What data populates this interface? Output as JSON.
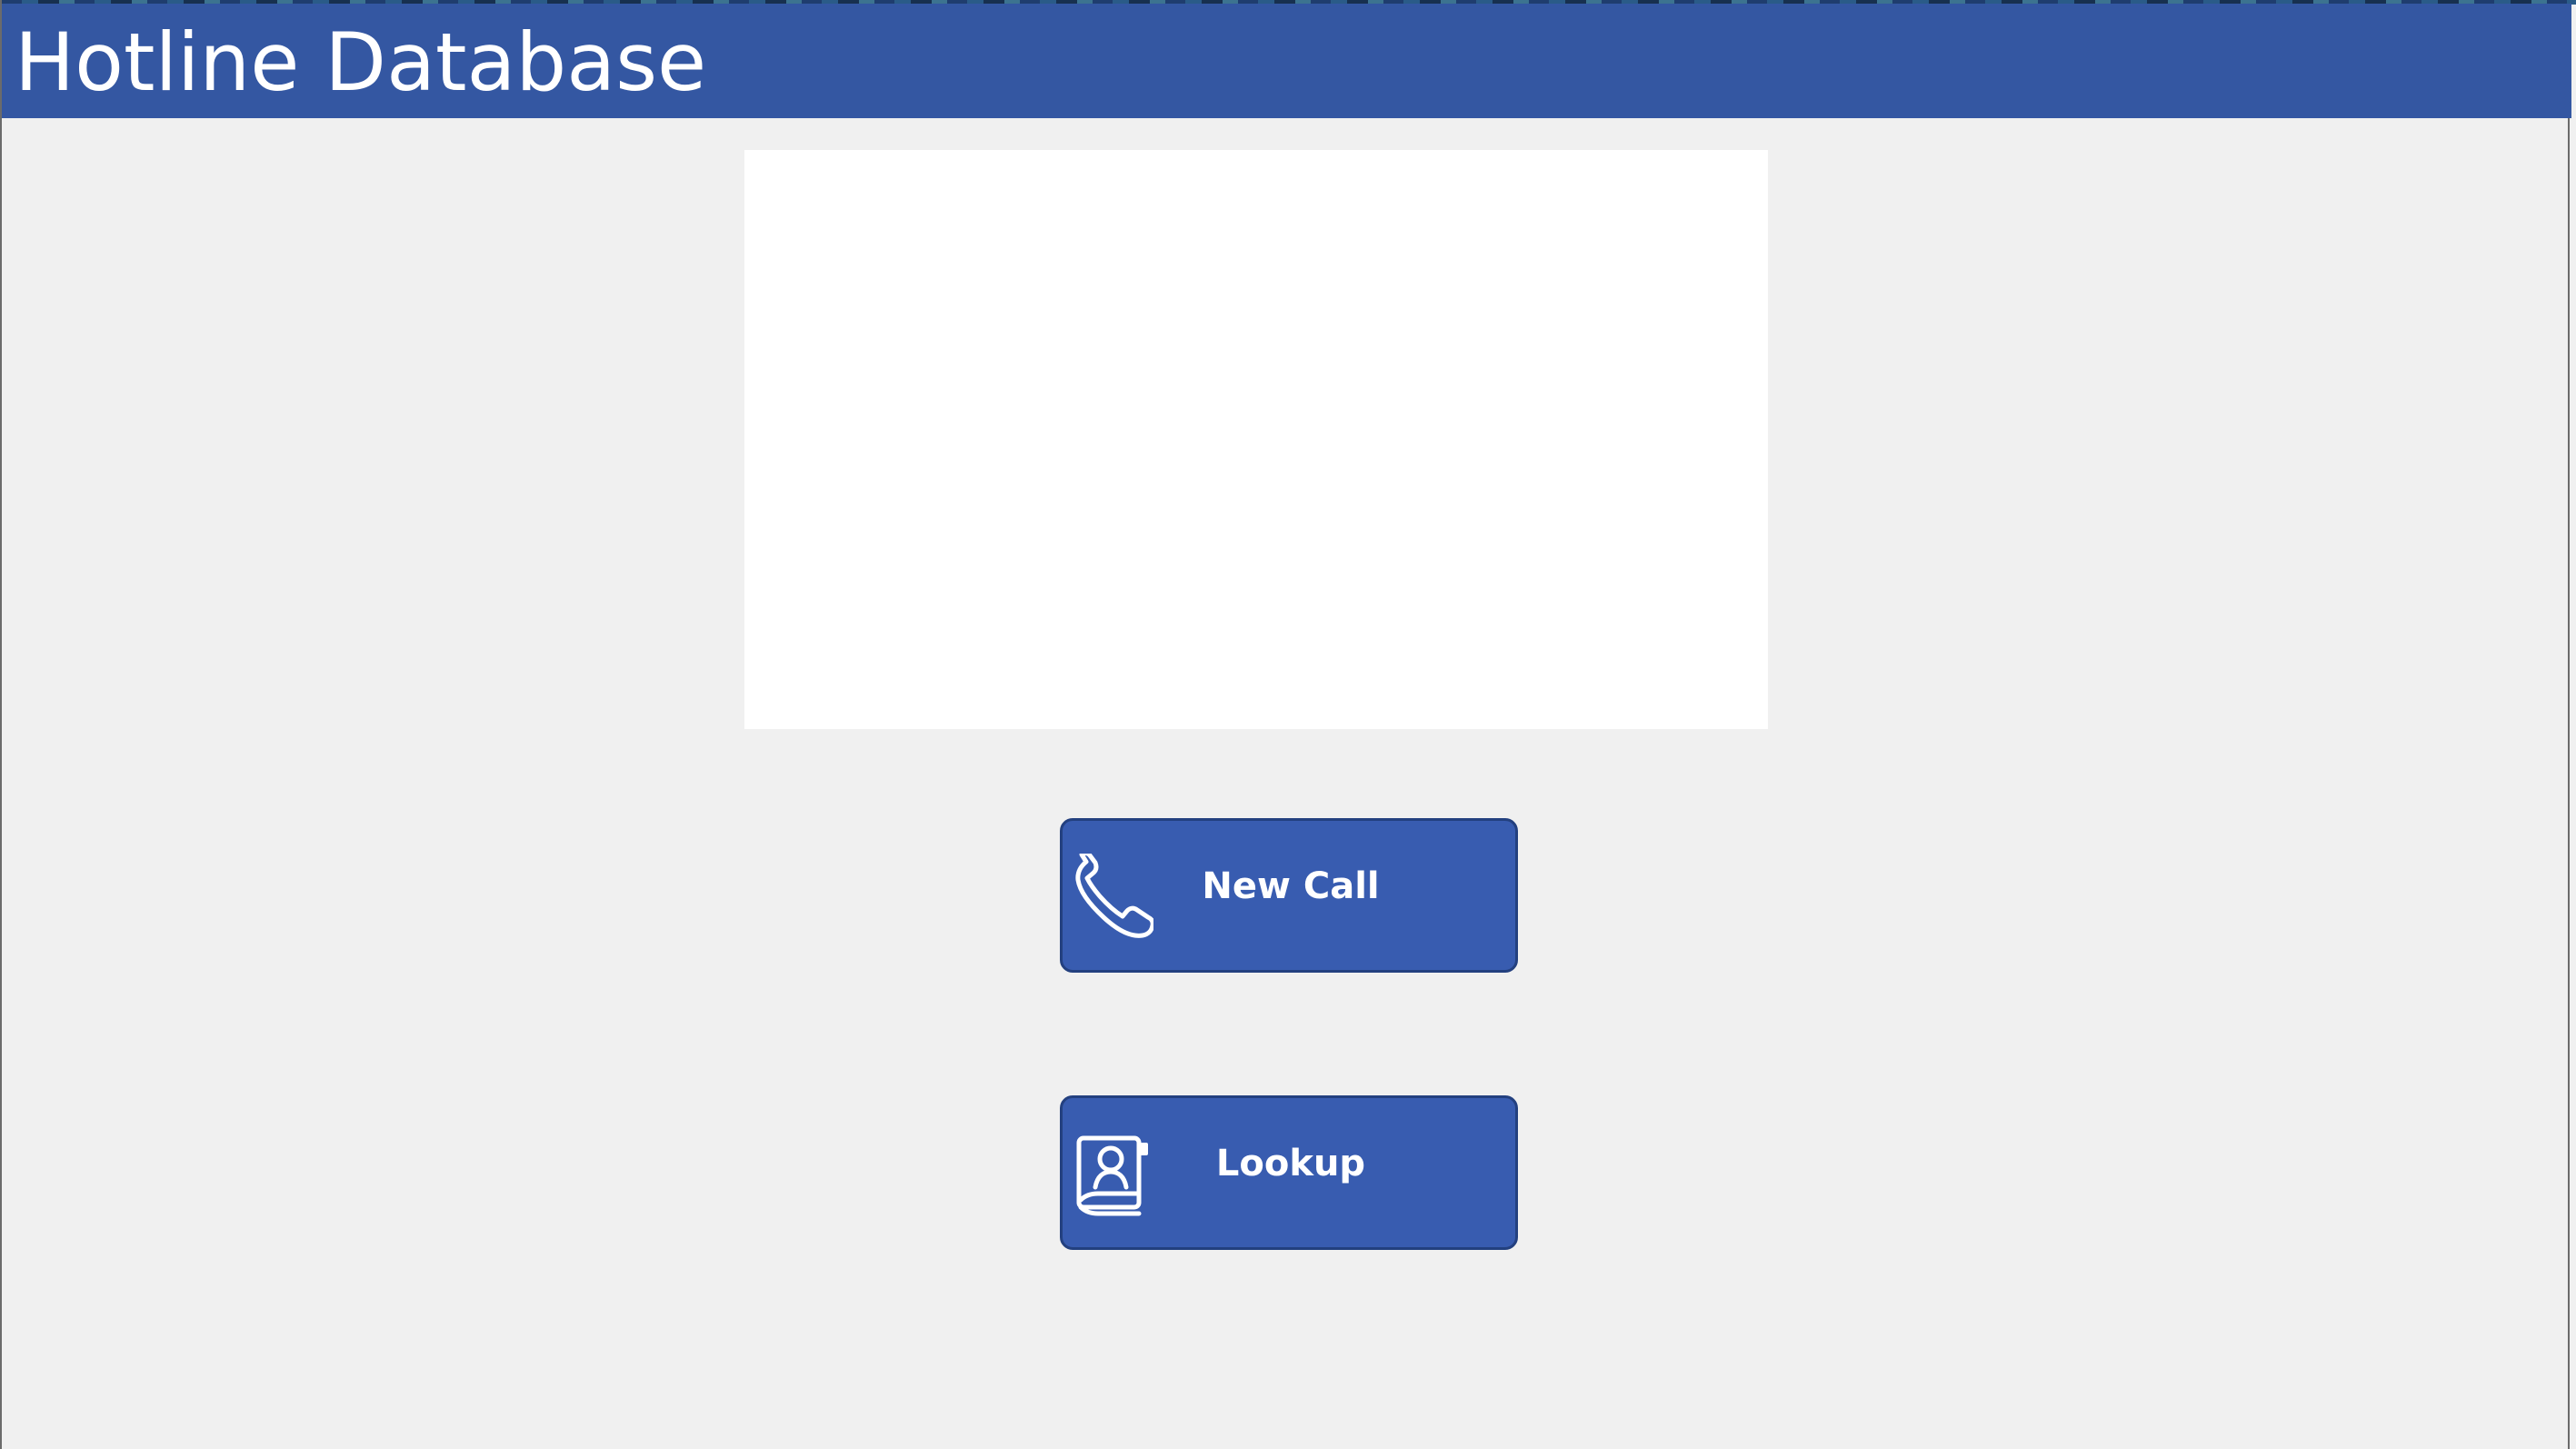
{
  "header": {
    "title": "Hotline Database"
  },
  "main": {
    "image_panel": {
      "content": ""
    },
    "buttons": [
      {
        "label": "New Call",
        "icon": "phone-icon"
      },
      {
        "label": "Lookup",
        "icon": "contact-book-icon"
      }
    ]
  },
  "colors": {
    "header": "#3457a2",
    "button_fill": "#385cb0",
    "button_border": "#23407f",
    "background": "#f0f0f0",
    "panel": "#ffffff",
    "text": "#ffffff"
  }
}
